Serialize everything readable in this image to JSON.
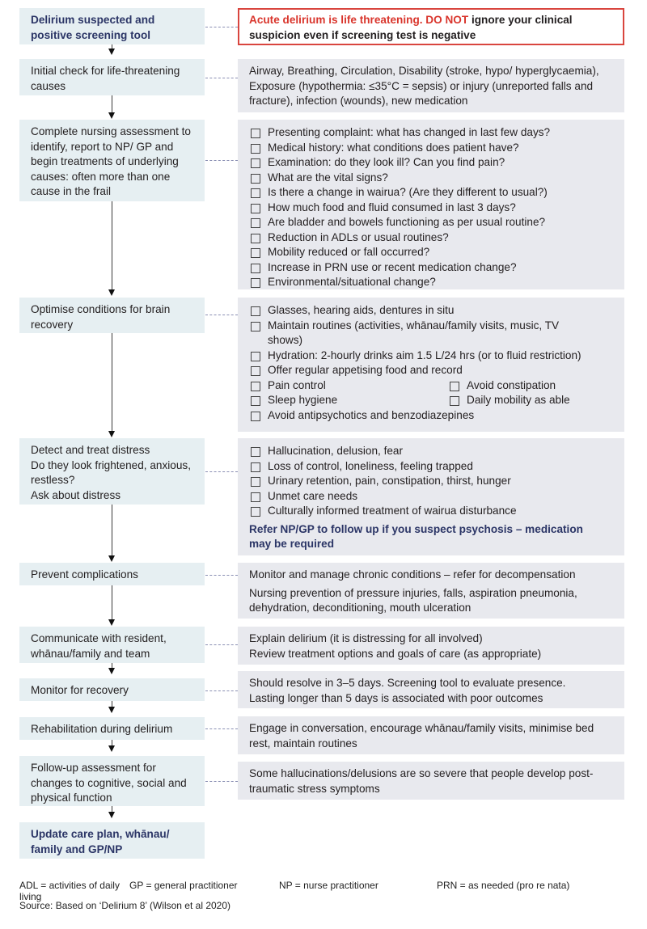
{
  "flowchart": {
    "steps": [
      {
        "label": "Delirium suspected and positive screening tool",
        "emphasis": "bold",
        "detail": {
          "type": "alert",
          "red_text": "Acute delirium is life threatening. DO NOT",
          "black_text": " ignore your clinical suspicion even if screening test is negative"
        }
      },
      {
        "label": "Initial check for life-threatening causes",
        "detail": {
          "type": "text",
          "paragraphs": [
            "Airway, Breathing, Circulation, Disability (stroke, hypo/ hyperglycaemia), Exposure (hypothermia: ≤35°C = sepsis) or injury (unreported falls and fracture), infection (wounds), new medication"
          ]
        }
      },
      {
        "label": "Complete nursing assessment to identify, report to NP/ GP and begin treatments of underlying causes: often more than one cause in the frail",
        "detail": {
          "type": "checklist",
          "items": [
            "Presenting complaint: what has changed in last few days?",
            "Medical history: what conditions does patient have?",
            "Examination: do they look ill? Can you find pain?",
            "What are the vital signs?",
            "Is there a change in wairua? (Are they different to usual?)",
            "How much food and fluid consumed in last 3 days?",
            "Are bladder and bowels functioning as per usual routine?",
            "Reduction in ADLs or usual routines?",
            "Mobility reduced or fall occurred?",
            "Increase in PRN use or recent medication change?",
            "Environmental/situational change?"
          ]
        }
      },
      {
        "label": "Optimise conditions for brain recovery",
        "detail": {
          "type": "checklist",
          "items": [
            "Glasses, hearing aids, dentures in situ",
            "Maintain routines (activities, whānau/family visits, music, TV shows)",
            "Hydration: 2-hourly drinks aim 1.5 L/24 hrs (or to fluid restriction)",
            "Offer regular appetising food and record"
          ],
          "pairs": [
            [
              "Pain control",
              "Avoid constipation"
            ],
            [
              "Sleep hygiene",
              "Daily mobility as able"
            ]
          ],
          "after": [
            "Avoid antipsychotics and benzodiazepines"
          ]
        }
      },
      {
        "label": "Detect and treat distress\nDo they look frightened, anxious, restless?\nAsk about distress",
        "label_lines": [
          "Detect and treat distress",
          "Do they look frightened, anxious, restless?",
          "Ask about distress"
        ],
        "detail": {
          "type": "checklist",
          "items": [
            "Hallucination, delusion, fear",
            "Loss of control, loneliness, feeling trapped",
            "Urinary retention, pain, constipation, thirst, hunger",
            "Unmet care needs",
            "Culturally informed treatment of wairua disturbance"
          ],
          "note": "Refer NP/GP to follow up if you suspect psychosis – medication may be required"
        }
      },
      {
        "label": "Prevent complications",
        "detail": {
          "type": "text",
          "paragraphs": [
            "Monitor and manage chronic conditions – refer for decompensation",
            "Nursing prevention of pressure injuries, falls, aspiration pneumonia, dehydration, deconditioning, mouth ulceration"
          ]
        }
      },
      {
        "label": "Communicate with resident, whānau/family and team",
        "detail": {
          "type": "lines",
          "lines": [
            "Explain delirium (it is distressing for all involved)",
            "Review treatment options and goals of care (as appropriate)"
          ]
        }
      },
      {
        "label": "Monitor for recovery",
        "detail": {
          "type": "lines",
          "lines": [
            "Should resolve in 3–5 days. Screening tool to evaluate presence.",
            "Lasting longer than 5 days is associated with poor outcomes"
          ]
        }
      },
      {
        "label": "Rehabilitation during delirium",
        "detail": {
          "type": "text",
          "paragraphs": [
            "Engage in conversation, encourage whānau/family visits, minimise bed rest, maintain routines"
          ]
        }
      },
      {
        "label": "Follow-up assessment for changes to cognitive, social and physical function",
        "detail": {
          "type": "text",
          "paragraphs": [
            "Some hallucinations/delusions are so severe that people develop post-traumatic stress symptoms"
          ]
        }
      },
      {
        "label": "Update care plan, whānau/ family and GP/NP",
        "emphasis": "bold"
      }
    ]
  },
  "footer": {
    "abbreviations": [
      "ADL = activities of daily living",
      "GP = general practitioner",
      "NP = nurse practitioner",
      "PRN = as needed (pro re nata)"
    ],
    "source": "Source: Based on ‘Delirium 8’ (Wilson et al 2020)"
  },
  "colors": {
    "step_box": "#e6eff2",
    "detail_box": "#e8e9ee",
    "alert_border": "#d9453e",
    "alert_text": "#d9352c",
    "emphasis_text": "#2b3566",
    "connector_dash": "#8a8fb3"
  }
}
